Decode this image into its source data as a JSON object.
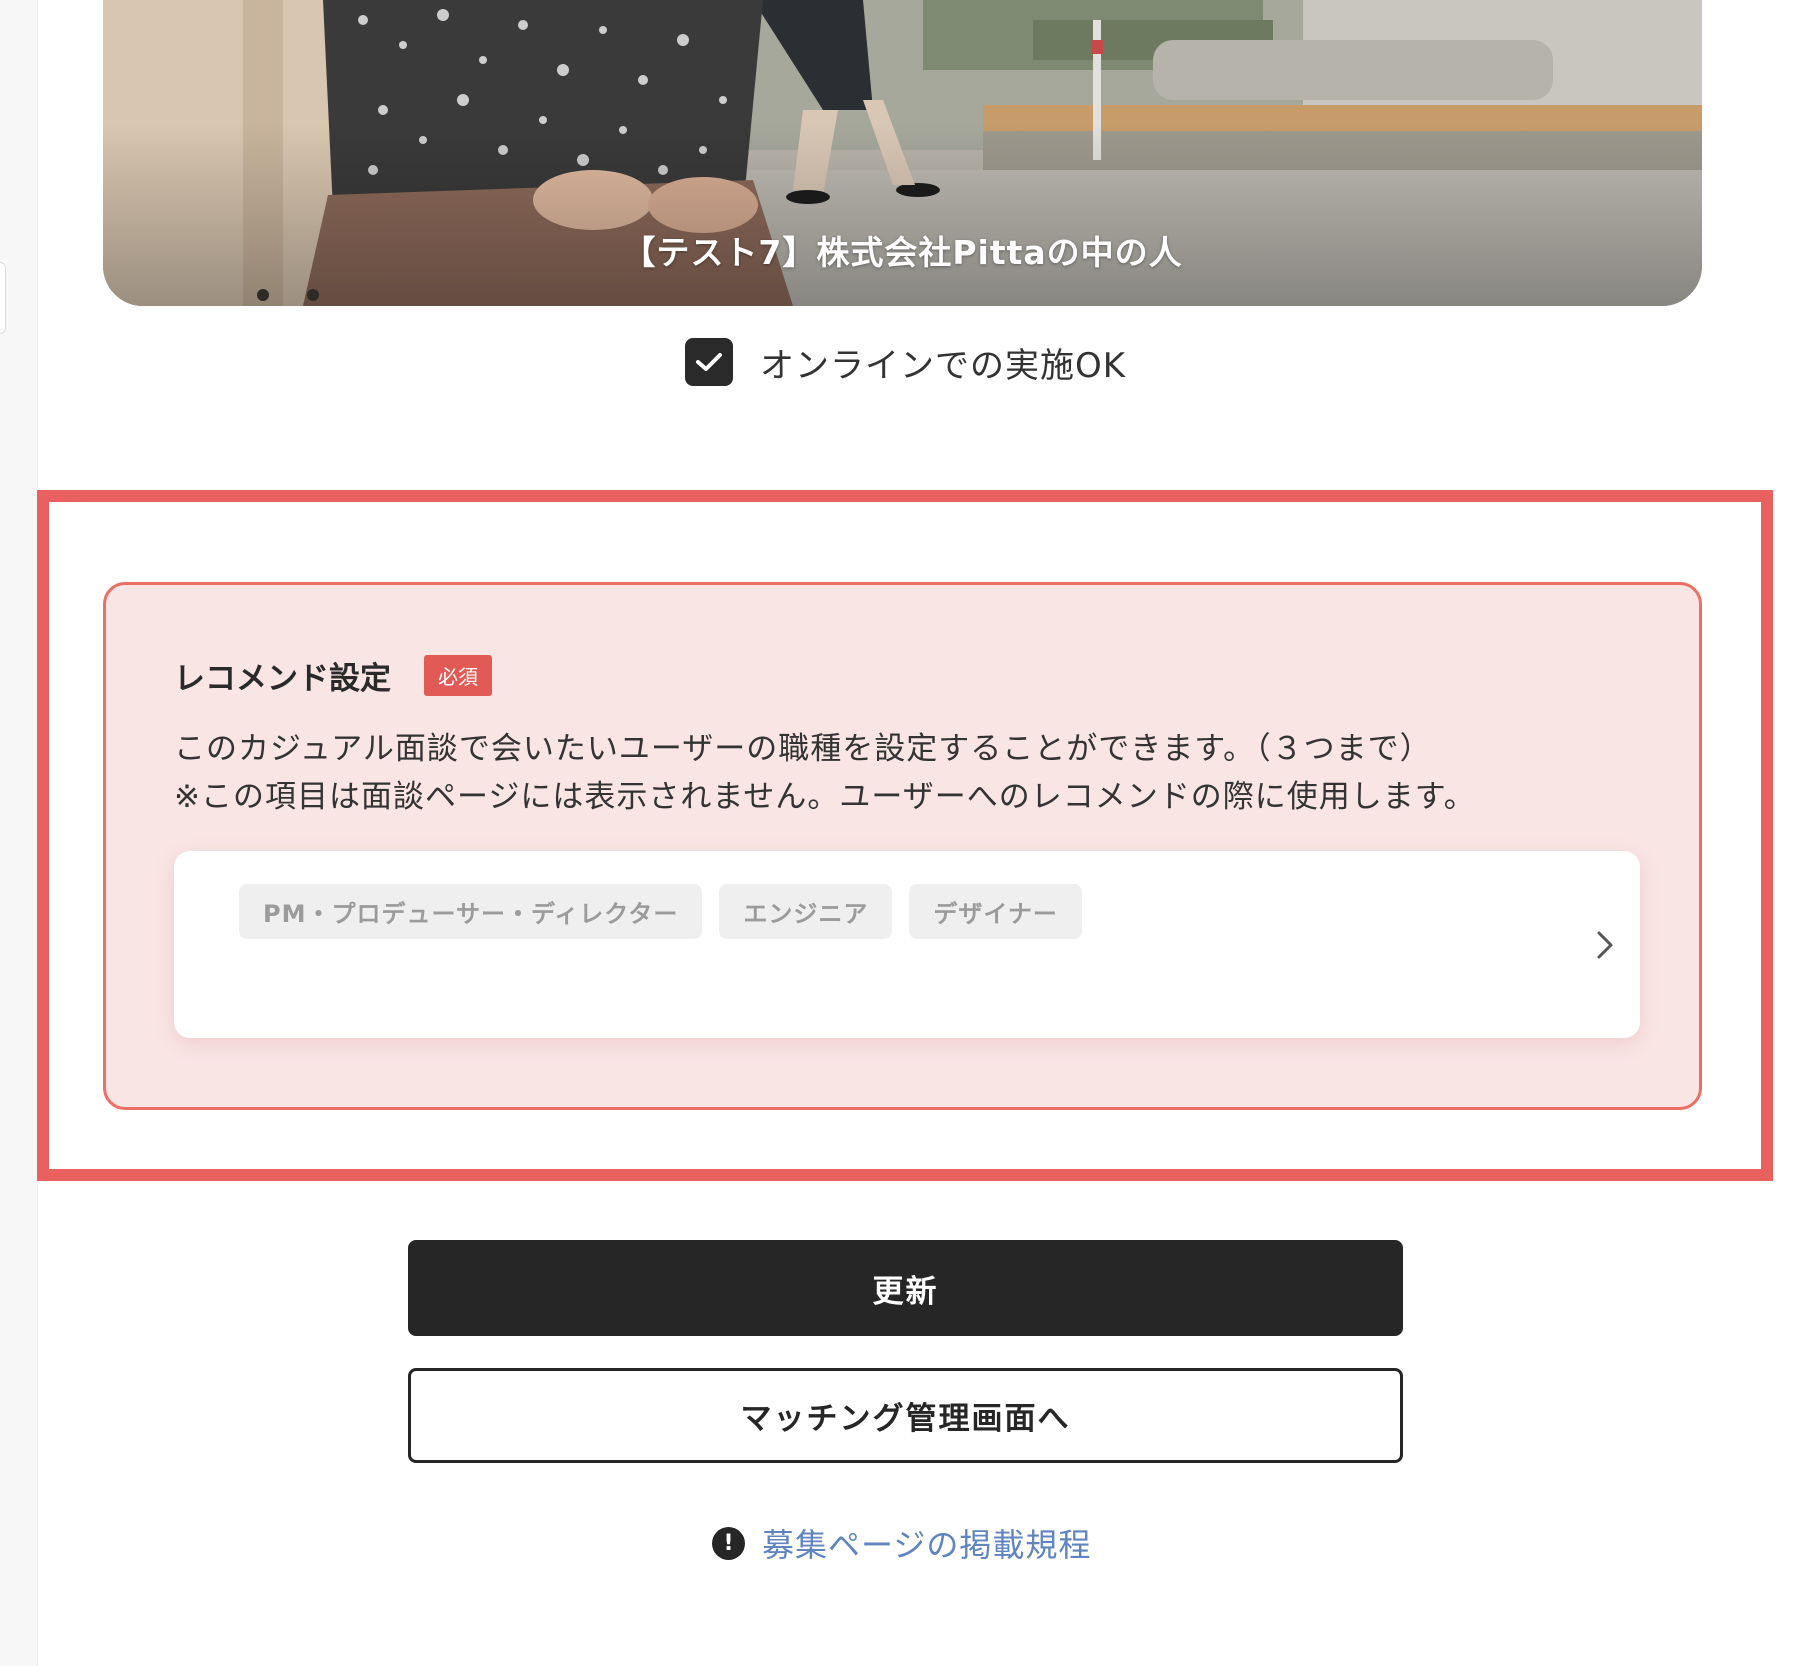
{
  "cover": {
    "caption": "【テスト7】株式会社Pittaの中の人"
  },
  "online": {
    "checked": true,
    "label": "オンラインでの実施OK"
  },
  "recommend": {
    "title": "レコメンド設定",
    "required_badge": "必須",
    "description_line1": "このカジュアル面談で会いたいユーザーの職種を設定することができます。（３つまで）",
    "description_line2": "※この項目は面談ページには表示されません。ユーザーへのレコメンドの際に使用します。",
    "selected_roles": [
      "PM・プロデューサー・ディレクター",
      "エンジニア",
      "デザイナー"
    ]
  },
  "actions": {
    "update_label": "更新",
    "matching_label": "マッチング管理画面へ"
  },
  "footer": {
    "rules_link": "募集ページの掲載規程"
  },
  "colors": {
    "highlight": "#e9615e",
    "card_bg": "#f9e5e4",
    "badge": "#e25a56",
    "primary_button": "#262626",
    "link": "#5f84bf"
  },
  "icons": {
    "checkbox": "check-icon",
    "chevron": "chevron-right-icon",
    "rules": "exclamation-circle-icon"
  }
}
